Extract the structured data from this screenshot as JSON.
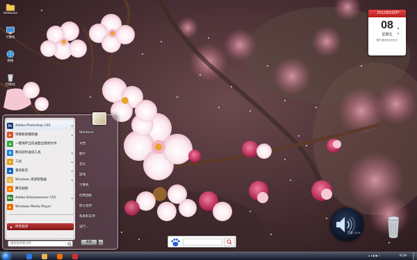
{
  "desktop": {
    "icons": [
      {
        "label": "Wallbase",
        "icon": "folder-icon"
      },
      {
        "label": "计算机",
        "icon": "computer-icon"
      },
      {
        "label": "网络",
        "icon": "network-icon"
      },
      {
        "label": "回收站",
        "icon": "recycle-bin-icon"
      }
    ]
  },
  "calendar": {
    "header": "2013年03月",
    "day": "08",
    "weekday": "星期五",
    "lunar": "癸巳(蛇)年正月廿七"
  },
  "start_menu": {
    "pinned": [
      {
        "label": "Adobe Photoshop CS5",
        "icon": "photoshop-icon",
        "color": "#1c3b73",
        "glyph": "Ps",
        "has_arrow": true
      },
      {
        "label": "快播极速播放器",
        "icon": "qvod-player-icon",
        "color": "#d9532a",
        "glyph": "▶",
        "has_arrow": true
      },
      {
        "label": "一键保存当前桌面主题到文件",
        "icon": "theme-save-icon",
        "color": "#3aa545",
        "glyph": "◉",
        "has_arrow": false
      },
      {
        "label": "腾讯即时通讯工具",
        "icon": "qq-icon",
        "color": "#1f86d8",
        "glyph": "Q",
        "has_arrow": true
      },
      {
        "label": "工具",
        "icon": "tools-icon",
        "color": "#e0a020",
        "glyph": "✚",
        "has_arrow": true
      },
      {
        "label": "暴风影音",
        "icon": "baofeng-icon",
        "color": "#1565c0",
        "glyph": "◆",
        "has_arrow": true
      },
      {
        "label": "Windows 资源管理器",
        "icon": "explorer-icon",
        "color": "#e8b34a",
        "glyph": "▤",
        "has_arrow": true
      },
      {
        "label": "腾讯视频",
        "icon": "tencent-video-icon",
        "color": "#ff7a00",
        "glyph": "▶",
        "has_arrow": false
      },
      {
        "label": "Adobe Dreamweaver CS5",
        "icon": "dreamweaver-icon",
        "color": "#2e7d32",
        "glyph": "Dw",
        "has_arrow": true
      },
      {
        "label": "Windows Media Player",
        "icon": "media-player-icon",
        "color": "#ef6c00",
        "glyph": "▶",
        "has_arrow": false
      }
    ],
    "all_programs": "所有程序",
    "search_placeholder": "搜索程序和文件",
    "right_items": [
      "Wallbase",
      "文档",
      "图片",
      "音乐",
      "游戏",
      "计算机",
      "控制面板",
      "默认程序",
      "帮助和支持",
      "运行..."
    ],
    "shutdown": "关机"
  },
  "search_box": {
    "value": ""
  },
  "volume": {
    "label": "音量: 21%",
    "level": 21
  },
  "taskbar": {
    "clock": "9:59",
    "pinned": [
      {
        "icon": "ie-icon",
        "color": "#2a7be0"
      },
      {
        "icon": "explorer-icon",
        "color": "#e8b34a"
      },
      {
        "icon": "media-player-icon",
        "color": "#ef6c00"
      },
      {
        "icon": "browser-icon",
        "color": "#d32f2f"
      }
    ]
  },
  "colors": {
    "accent": "#b71c1c",
    "start_orb": "#1d68c8"
  }
}
